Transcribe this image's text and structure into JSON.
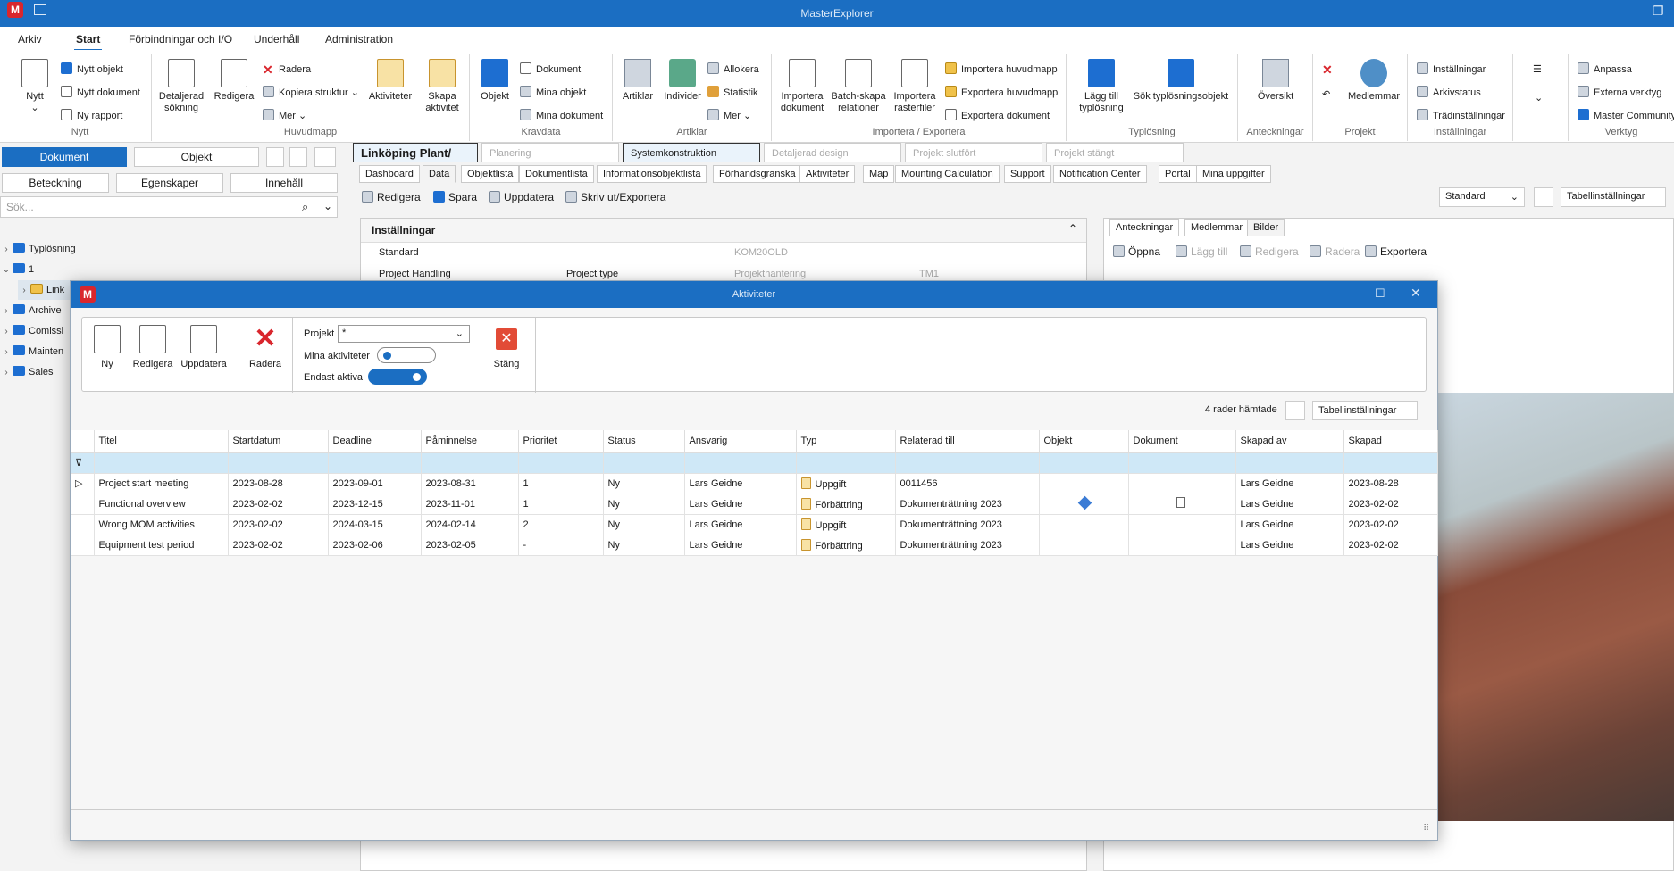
{
  "app": {
    "title": "MasterExplorer"
  },
  "menu": [
    "Arkiv",
    "Start",
    "Förbindningar och I/O",
    "Underhåll",
    "Administration"
  ],
  "ribbon": {
    "nytt": {
      "label": "Nytt",
      "big": "Nytt",
      "items": [
        "Nytt objekt",
        "Nytt dokument",
        "Ny rapport"
      ]
    },
    "huvudmapp": {
      "label": "Huvudmapp",
      "big1": "Detaljerad sökning",
      "big2": "Redigera",
      "items": [
        "Radera",
        "Kopiera struktur",
        "Mer"
      ],
      "big3": "Aktiviteter",
      "big4": "Skapa aktivitet"
    },
    "kravdata": {
      "label": "Kravdata",
      "big": "Objekt",
      "items": [
        "Dokument",
        "Mina objekt",
        "Mina dokument"
      ]
    },
    "artiklar": {
      "label": "Artiklar",
      "big1": "Artiklar",
      "big2": "Individer",
      "items": [
        "Allokera",
        "Statistik",
        "Mer"
      ]
    },
    "import": {
      "label": "Importera / Exportera",
      "big1": "Importera dokument",
      "big2": "Batch-skapa relationer",
      "big3": "Importera rasterfiler",
      "items": [
        "Importera huvudmapp",
        "Exportera huvudmapp",
        "Exportera dokument"
      ]
    },
    "typlosning": {
      "label": "Typlösning",
      "big1": "Lägg till typlösning",
      "big2": "Sök typlösningsobjekt"
    },
    "anteckningar": {
      "label": "Anteckningar",
      "big": "Översikt"
    },
    "projekt": {
      "label": "Projekt",
      "big": "Medlemmar"
    },
    "installningar": {
      "label": "Inställningar",
      "items": [
        "Inställningar",
        "Arkivstatus",
        "Trädinställningar"
      ]
    },
    "verktyg": {
      "label": "Verktyg",
      "items": [
        "Anpassa",
        "Externa verktyg",
        "Master Community"
      ]
    }
  },
  "left": {
    "btn_dokument": "Dokument",
    "btn_objekt": "Objekt",
    "btn_beteckning": "Beteckning",
    "btn_egenskaper": "Egenskaper",
    "btn_innehall": "Innehåll",
    "search_placeholder": "Sök...",
    "tree": [
      "Typlösning",
      "1",
      "Link",
      "Archive",
      "Comissi",
      "Mainten",
      "Sales"
    ]
  },
  "main": {
    "project": "Linköping Plant/",
    "crumbs": [
      "Planering",
      "Systemkonstruktion",
      "Detaljerad design",
      "Projekt slutfört",
      "Projekt stängt"
    ],
    "tabs": [
      "Dashboard",
      "Data",
      "Objektlista",
      "Dokumentlista",
      "Informationsobjektlista",
      "Förhandsgranska",
      "Aktiviteter",
      "Map",
      "Mounting Calculation",
      "Support",
      "Notification Center",
      "Portal",
      "Mina uppgifter"
    ],
    "toolbar": [
      "Redigera",
      "Spara",
      "Uppdatera",
      "Skriv ut/Exportera"
    ],
    "view_select": "Standard",
    "table_settings": "Tabellinställningar",
    "settings_title": "Inställningar",
    "settings_rows": [
      {
        "label": "Standard",
        "value": "KOM20OLD"
      },
      {
        "label": "Project Handling",
        "label2": "Project type",
        "value": "Projekthantering",
        "value2": "TM1"
      }
    ],
    "right_tabs": [
      "Anteckningar",
      "Medlemmar",
      "Bilder"
    ],
    "right_tools": [
      "Öppna",
      "Lägg till",
      "Redigera",
      "Radera",
      "Exportera"
    ]
  },
  "dialog": {
    "title": "Aktiviteter",
    "tools": {
      "ny": "Ny",
      "redigera": "Redigera",
      "uppdatera": "Uppdatera",
      "radera": "Radera",
      "stang": "Stäng"
    },
    "projekt_label": "Projekt",
    "projekt_value": "*",
    "mina_label": "Mina aktiviteter",
    "endast_label": "Endast aktiva",
    "rows_info": "4 rader hämtade",
    "table_settings": "Tabellinställningar",
    "columns": [
      "Titel",
      "Startdatum",
      "Deadline",
      "Påminnelse",
      "Prioritet",
      "Status",
      "Ansvarig",
      "Typ",
      "Relaterad till",
      "Objekt",
      "Dokument",
      "Skapad av",
      "Skapad"
    ],
    "rows": [
      [
        "Project start meeting",
        "2023-08-28",
        "2023-09-01",
        "2023-08-31",
        "1",
        "Ny",
        "Lars Geidne",
        "Uppgift",
        "0011456",
        "",
        "",
        "Lars Geidne",
        "2023-08-28"
      ],
      [
        "Functional overview",
        "2023-02-02",
        "2023-12-15",
        "2023-11-01",
        "1",
        "Ny",
        "Lars Geidne",
        "Förbättring",
        "Dokumenträttning 2023",
        "",
        "",
        "Lars Geidne",
        "2023-02-02"
      ],
      [
        "Wrong MOM activities",
        "2023-02-02",
        "2024-03-15",
        "2024-02-14",
        "2",
        "Ny",
        "Lars Geidne",
        "Uppgift",
        "Dokumenträttning 2023",
        "",
        "",
        "Lars Geidne",
        "2023-02-02"
      ],
      [
        "Equipment test period",
        "2023-02-02",
        "2023-02-06",
        "2023-02-05",
        "-",
        "Ny",
        "Lars Geidne",
        "Förbättring",
        "Dokumenträttning 2023",
        "",
        "",
        "Lars Geidne",
        "2023-02-02"
      ]
    ]
  }
}
